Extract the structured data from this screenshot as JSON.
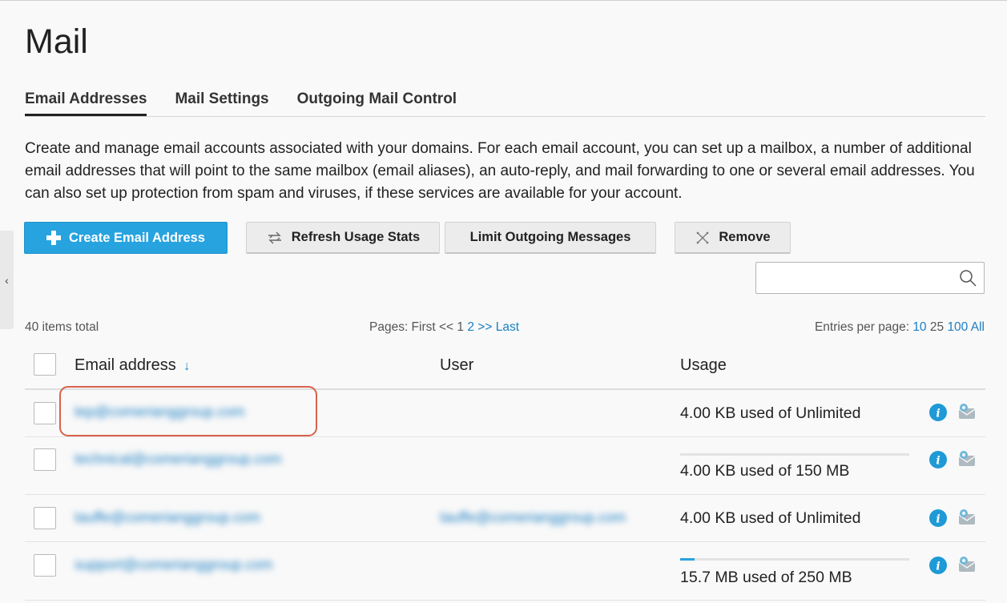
{
  "page": {
    "title": "Mail"
  },
  "tabs": [
    {
      "label": "Email Addresses",
      "active": true
    },
    {
      "label": "Mail Settings",
      "active": false
    },
    {
      "label": "Outgoing Mail Control",
      "active": false
    }
  ],
  "description": "Create and manage email accounts associated with your domains. For each email account, you can set up a mailbox, a number of additional email addresses that will point to the same mailbox (email aliases), an auto-reply, and mail forwarding to one or several email addresses. You can also set up protection from spam and viruses, if these services are available for your account.",
  "toolbar": {
    "create_label": "Create Email Address",
    "refresh_label": "Refresh Usage Stats",
    "limit_label": "Limit Outgoing Messages",
    "remove_label": "Remove"
  },
  "search": {
    "placeholder": "",
    "value": ""
  },
  "list_info": {
    "total": "40 items total",
    "pages_prefix": "Pages: First <<",
    "page_current": "1",
    "page_next": "2",
    "pages_suffix": ">> Last",
    "entries_prefix": "Entries per page:",
    "entries_10": "10",
    "entries_25": "25",
    "entries_100": "100",
    "entries_all": "All"
  },
  "table": {
    "columns": {
      "email": "Email address",
      "sort_indicator": "↓",
      "user": "User",
      "usage": "Usage"
    },
    "rows": [
      {
        "email": "tep@comerianggroup.com",
        "user": "",
        "usage": "4.00 KB used of Unlimited",
        "usage_fraction": null
      },
      {
        "email": "technical@comerianggroup.com",
        "user": "",
        "usage": "4.00 KB used of 150 MB",
        "usage_fraction": 0.0
      },
      {
        "email": "tauffe@comerianggroup.com",
        "user": "tauffe@comerianggroup.com",
        "usage": "4.00 KB used of Unlimited",
        "usage_fraction": null
      },
      {
        "email": "support@comerianggroup.com",
        "user": "",
        "usage": "15.7 MB used of 250 MB",
        "usage_fraction": 0.063
      }
    ]
  },
  "icons": {
    "info": "info-icon",
    "mail": "mailbox-icon",
    "search": "search-icon",
    "plus": "plus-icon",
    "refresh": "refresh-icon",
    "remove": "remove-icon",
    "collapse": "chevron-left-icon"
  },
  "colors": {
    "accent": "#27a3df",
    "link": "#1b7ec3",
    "highlight": "#d9614b"
  }
}
